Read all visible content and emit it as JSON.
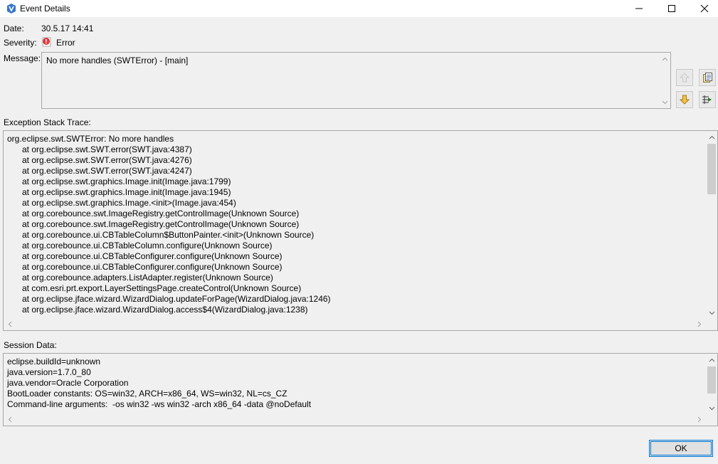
{
  "window": {
    "title": "Event Details"
  },
  "fields": {
    "date_label": "Date:",
    "date_value": "30.5.17 14:41",
    "severity_label": "Severity:",
    "severity_value": "Error",
    "message_label": "Message:",
    "message_value": "No more handles (SWTError) - [main]"
  },
  "icons": {
    "app": "eclipse-app-icon",
    "severity": "error-icon",
    "previous": "arrow-up-icon",
    "next": "arrow-down-icon",
    "copy": "copy-clipboard-icon",
    "filter": "filter-stack-icon"
  },
  "colors": {
    "accent": "#0078d7",
    "error": "#e0393e",
    "arrow_enabled": "#e8b43c",
    "arrow_disabled": "#cccccc"
  },
  "exception": {
    "label": "Exception Stack Trace:",
    "first_line": "org.eclipse.swt.SWTError: No more handles",
    "frames": [
      "at org.eclipse.swt.SWT.error(SWT.java:4387)",
      "at org.eclipse.swt.SWT.error(SWT.java:4276)",
      "at org.eclipse.swt.SWT.error(SWT.java:4247)",
      "at org.eclipse.swt.graphics.Image.init(Image.java:1799)",
      "at org.eclipse.swt.graphics.Image.init(Image.java:1945)",
      "at org.eclipse.swt.graphics.Image.<init>(Image.java:454)",
      "at org.corebounce.swt.ImageRegistry.getControlImage(Unknown Source)",
      "at org.corebounce.swt.ImageRegistry.getControlImage(Unknown Source)",
      "at org.corebounce.ui.CBTableColumn$ButtonPainter.<init>(Unknown Source)",
      "at org.corebounce.ui.CBTableColumn.configure(Unknown Source)",
      "at org.corebounce.ui.CBTableConfigurer.configure(Unknown Source)",
      "at org.corebounce.ui.CBTableConfigurer.configure(Unknown Source)",
      "at org.corebounce.adapters.ListAdapter.register(Unknown Source)",
      "at com.esri.prt.export.LayerSettingsPage.createControl(Unknown Source)",
      "at org.eclipse.jface.wizard.WizardDialog.updateForPage(WizardDialog.java:1246)",
      "at org.eclipse.jface.wizard.WizardDialog.access$4(WizardDialog.java:1238)"
    ]
  },
  "session": {
    "label": "Session Data:",
    "lines": [
      "eclipse.buildId=unknown",
      "java.version=1.7.0_80",
      "java.vendor=Oracle Corporation",
      "BootLoader constants: OS=win32, ARCH=x86_64, WS=win32, NL=cs_CZ",
      "Command-line arguments:  -os win32 -ws win32 -arch x86_64 -data @noDefault"
    ]
  },
  "buttons": {
    "ok_label": "OK"
  }
}
